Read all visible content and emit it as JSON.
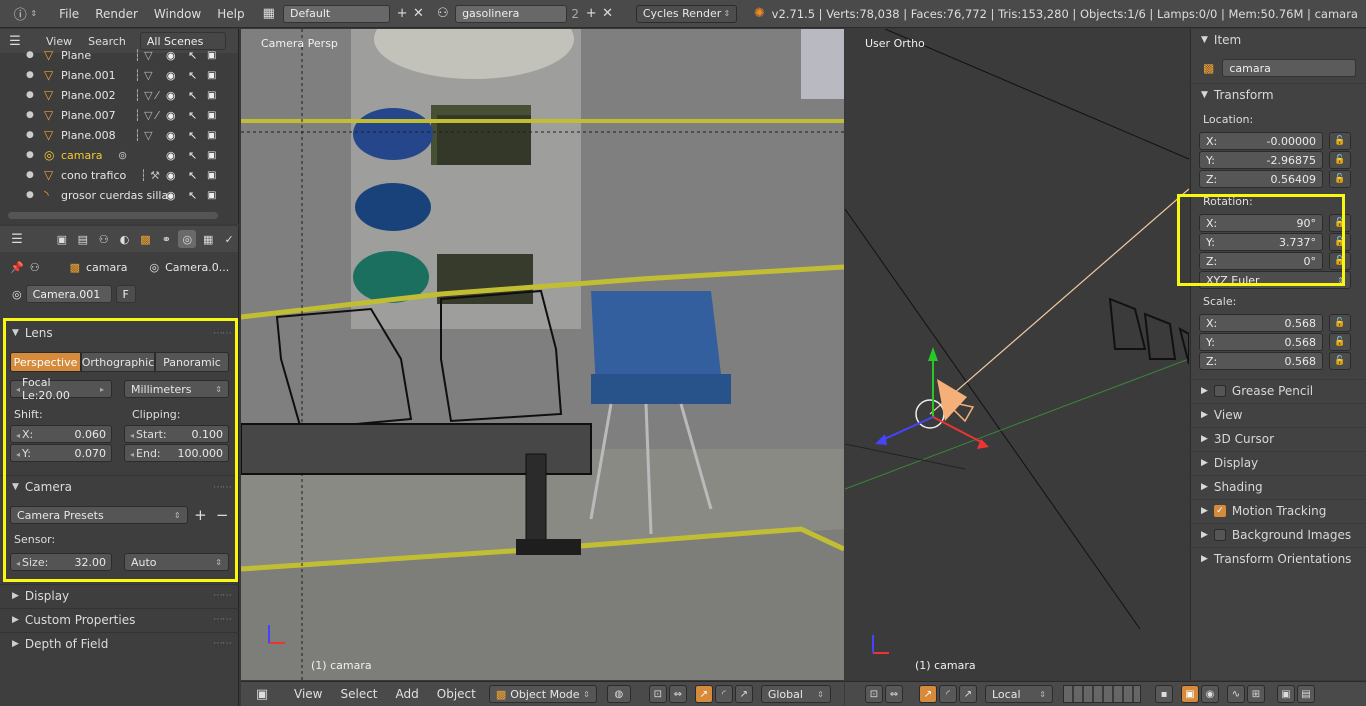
{
  "topbar": {
    "menus": [
      "File",
      "Render",
      "Window",
      "Help"
    ],
    "layout": "Default",
    "scene": "gasolinera",
    "scene_users": "2",
    "engine": "Cycles Render",
    "stats": "v2.71.5 | Verts:78,038 | Faces:76,772 | Tris:153,280 | Objects:1/6 | Lamps:0/0 | Mem:50.76M | camara"
  },
  "outliner": {
    "tabs": [
      "View",
      "Search",
      "All Scenes"
    ],
    "rows": [
      {
        "name": "Plane"
      },
      {
        "name": "Plane.001"
      },
      {
        "name": "Plane.002"
      },
      {
        "name": "Plane.007"
      },
      {
        "name": "Plane.008"
      },
      {
        "name": "camara"
      },
      {
        "name": "cono trafico"
      },
      {
        "name": "grosor cuerdas silla"
      }
    ]
  },
  "properties": {
    "object_name": "camara",
    "data_name": "Camera.0...",
    "datablock": "Camera.001",
    "datablock_fake": "F",
    "lens": {
      "title": "Lens",
      "modes": [
        "Perspective",
        "Orthographic",
        "Panoramic"
      ],
      "focal": "Focal Le:20.00",
      "units": "Millimeters",
      "shift_label": "Shift:",
      "clip_label": "Clipping:",
      "shift_x_label": "X:",
      "shift_x": "0.060",
      "shift_y_label": "Y:",
      "shift_y": "0.070",
      "clip_start_label": "Start:",
      "clip_start": "0.100",
      "clip_end_label": "End:",
      "clip_end": "100.000"
    },
    "camera": {
      "title": "Camera",
      "presets": "Camera Presets",
      "sensor_label": "Sensor:",
      "size_label": "Size:",
      "size": "32.00",
      "fit": "Auto"
    },
    "collapsed": [
      "Display",
      "Custom Properties",
      "Depth of Field"
    ]
  },
  "viewport_left": {
    "label": "Camera Persp",
    "object": "(1) camara"
  },
  "viewport_right": {
    "label": "User Ortho",
    "object": "(1) camara"
  },
  "npanel": {
    "item_title": "Item",
    "item_name": "camara",
    "transform_title": "Transform",
    "location_label": "Location:",
    "loc": [
      {
        "axis": "X:",
        "val": "-0.00000"
      },
      {
        "axis": "Y:",
        "val": "-2.96875"
      },
      {
        "axis": "Z:",
        "val": "0.56409"
      }
    ],
    "rotation_label": "Rotation:",
    "rot": [
      {
        "axis": "X:",
        "val": "90°"
      },
      {
        "axis": "Y:",
        "val": "3.737°"
      },
      {
        "axis": "Z:",
        "val": "0°"
      }
    ],
    "rot_mode": "XYZ Euler",
    "scale_label": "Scale:",
    "scale": [
      {
        "axis": "X:",
        "val": "0.568"
      },
      {
        "axis": "Y:",
        "val": "0.568"
      },
      {
        "axis": "Z:",
        "val": "0.568"
      }
    ],
    "sections": [
      "Grease Pencil",
      "View",
      "3D Cursor",
      "Display",
      "Shading",
      "Motion Tracking",
      "Background Images",
      "Transform Orientations"
    ]
  },
  "bottom_left": {
    "menus": [
      "View",
      "Select",
      "Add",
      "Object"
    ],
    "mode": "Object Mode",
    "orientation": "Global"
  },
  "bottom_right": {
    "orientation": "Local"
  },
  "colors": {
    "highlight": "#f7f711",
    "accent": "#d68a3c",
    "object_selected": "#f5c830"
  }
}
